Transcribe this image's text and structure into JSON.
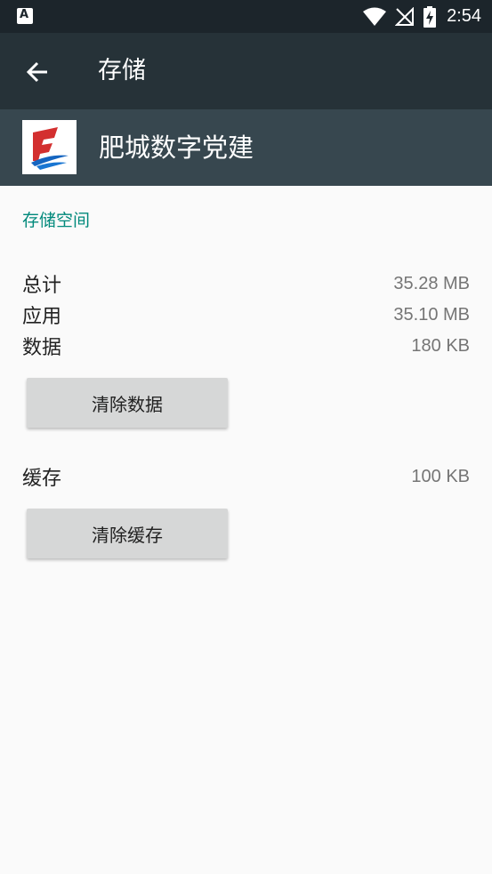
{
  "status_bar": {
    "time": "2:54",
    "notification_icon": "a-icon"
  },
  "toolbar": {
    "title": "存储",
    "back_icon": "arrow-left-icon"
  },
  "app": {
    "name": "肥城数字党建"
  },
  "storage": {
    "section_title": "存储空间",
    "rows": [
      {
        "label": "总计",
        "value": "35.28 MB"
      },
      {
        "label": "应用",
        "value": "35.10 MB"
      },
      {
        "label": "数据",
        "value": "180 KB"
      }
    ],
    "clear_data_button": "清除数据",
    "cache": {
      "label": "缓存",
      "value": "100 KB"
    },
    "clear_cache_button": "清除缓存"
  },
  "colors": {
    "toolbar": "#263238",
    "app_header": "#37474f",
    "accent": "#00897b",
    "status_bar": "#1c252b"
  }
}
